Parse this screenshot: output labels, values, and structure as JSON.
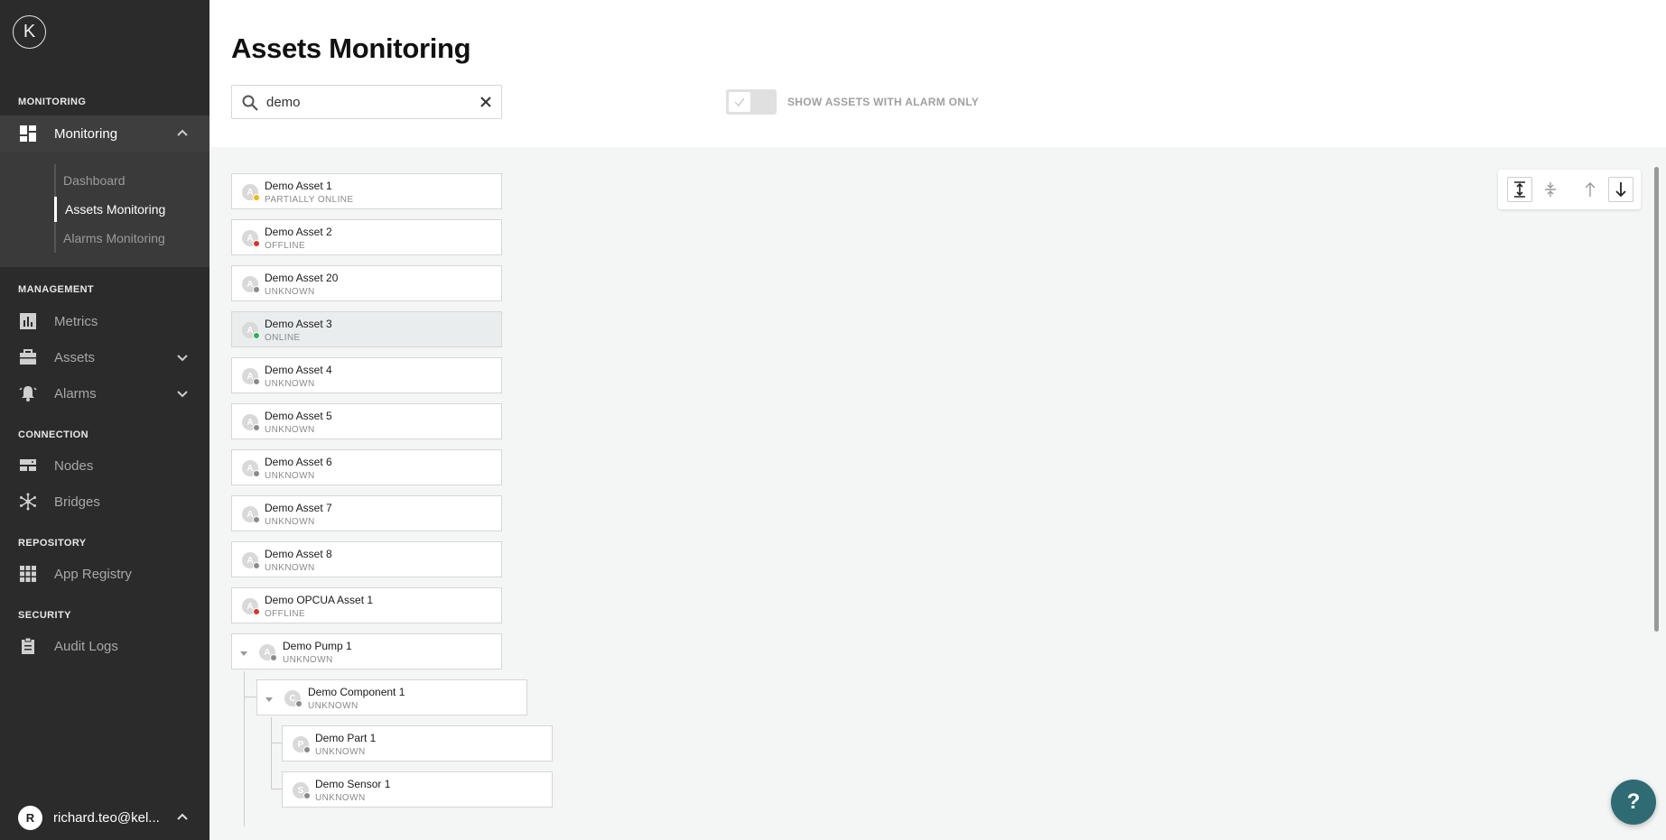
{
  "logo": {
    "text": "K"
  },
  "sidebar": {
    "sections": {
      "monitoring": "MONITORING",
      "management": "MANAGEMENT",
      "connection": "CONNECTION",
      "repository": "REPOSITORY",
      "security": "SECURITY"
    },
    "monitoring_label": "Monitoring",
    "submenu": [
      "Dashboard",
      "Assets Monitoring",
      "Alarms Monitoring"
    ],
    "metrics": "Metrics",
    "assets": "Assets",
    "alarms": "Alarms",
    "nodes": "Nodes",
    "bridges": "Bridges",
    "app_registry": "App Registry",
    "audit_logs": "Audit Logs",
    "user": {
      "initial": "R",
      "name": "richard.teo@kel..."
    }
  },
  "header": {
    "title": "Assets Monitoring",
    "search_value": "demo",
    "toggle_label": "SHOW ASSETS WITH ALARM ONLY"
  },
  "colors": {
    "partial": "#f2b705",
    "offline": "#d9342b",
    "online": "#2fae5b",
    "unknown": "#8a8a8a"
  },
  "assets": [
    {
      "name": "Demo Asset 1",
      "status": "PARTIALLY ONLINE",
      "icon": "A"
    },
    {
      "name": "Demo Asset 2",
      "status": "OFFLINE",
      "icon": "A"
    },
    {
      "name": "Demo Asset 20",
      "status": "UNKNOWN",
      "icon": "A"
    },
    {
      "name": "Demo Asset 3",
      "status": "ONLINE",
      "icon": "A"
    },
    {
      "name": "Demo Asset 4",
      "status": "UNKNOWN",
      "icon": "A"
    },
    {
      "name": "Demo Asset 5",
      "status": "UNKNOWN",
      "icon": "A"
    },
    {
      "name": "Demo Asset 6",
      "status": "UNKNOWN",
      "icon": "A"
    },
    {
      "name": "Demo Asset 7",
      "status": "UNKNOWN",
      "icon": "A"
    },
    {
      "name": "Demo Asset 8",
      "status": "UNKNOWN",
      "icon": "A"
    },
    {
      "name": "Demo OPCUA Asset 1",
      "status": "OFFLINE",
      "icon": "A"
    },
    {
      "name": "Demo Pump 1",
      "status": "UNKNOWN",
      "icon": "A"
    },
    {
      "name": "Demo Component 1",
      "status": "UNKNOWN",
      "icon": "C"
    },
    {
      "name": "Demo Part 1",
      "status": "UNKNOWN",
      "icon": "P"
    },
    {
      "name": "Demo Sensor 1",
      "status": "UNKNOWN",
      "icon": "S"
    }
  ],
  "help": {
    "label": "?"
  }
}
